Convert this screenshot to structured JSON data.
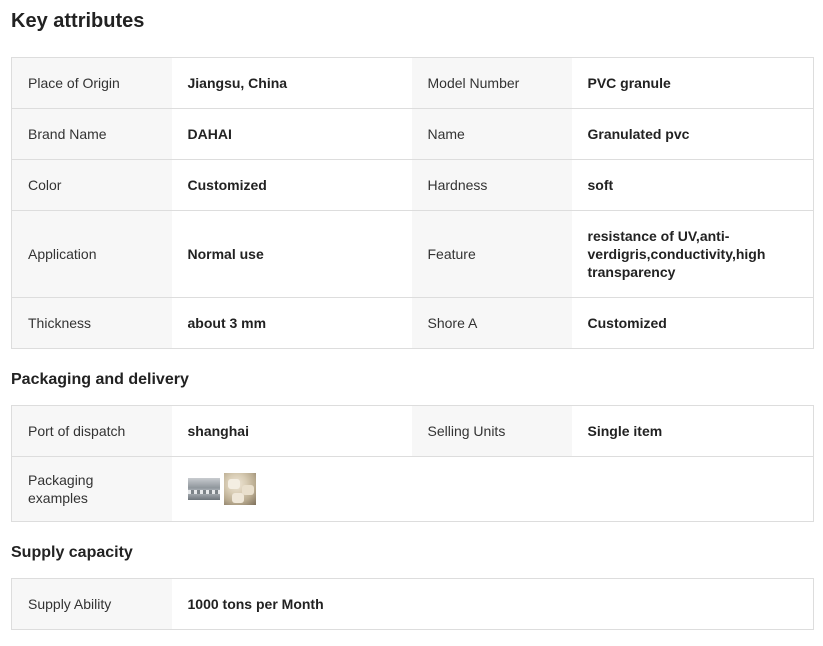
{
  "key_attributes": {
    "title": "Key attributes",
    "rows": [
      {
        "k1": "Place of Origin",
        "v1": "Jiangsu, China",
        "k2": "Model Number",
        "v2": "PVC granule"
      },
      {
        "k1": "Brand Name",
        "v1": "DAHAI",
        "k2": "Name",
        "v2": "Granulated pvc"
      },
      {
        "k1": "Color",
        "v1": "Customized",
        "k2": "Hardness",
        "v2": "soft"
      },
      {
        "k1": "Application",
        "v1": "Normal use",
        "k2": "Feature",
        "v2": "resistance of UV,anti-verdigris,conductivity,high transparency"
      },
      {
        "k1": "Thickness",
        "v1": "about 3 mm",
        "k2": "Shore A",
        "v2": "Customized"
      }
    ]
  },
  "packaging": {
    "title": "Packaging and delivery",
    "port_label": "Port of dispatch",
    "port_value": "shanghai",
    "units_label": "Selling Units",
    "units_value": "Single item",
    "examples_label": "Packaging examples"
  },
  "supply": {
    "title": "Supply capacity",
    "ability_label": "Supply Ability",
    "ability_value": "1000 tons per Month"
  }
}
